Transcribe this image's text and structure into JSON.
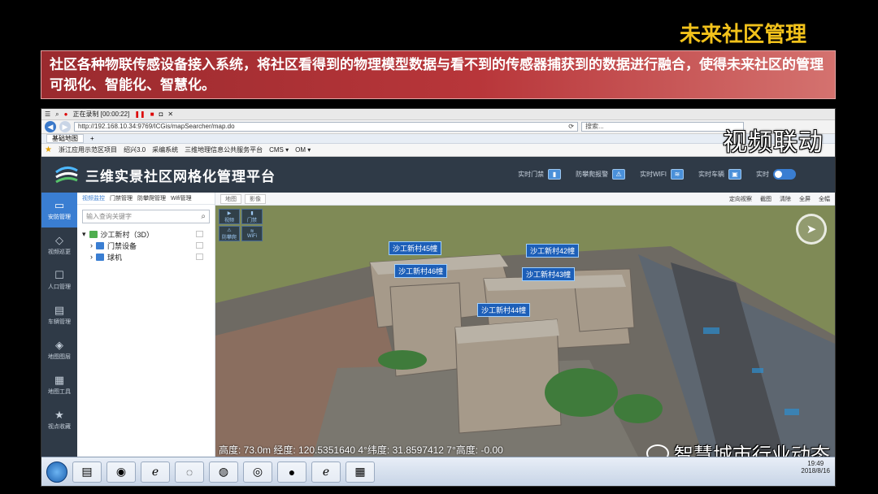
{
  "slide": {
    "title": "未来社区管理",
    "banner": "社区各种物联传感设备接入系统，将社区看得到的物理模型数据与看不到的传感器捕获到的数据进行融合，使得未来社区的管理可视化、智能化、智慧化。",
    "video_link": "视频联动",
    "watermark": "智慧城市行业动态"
  },
  "browser": {
    "recording": "正在录制 [00:00:22]",
    "url": "http://192.168.10.34:9769/ICGis/mapSearcher/map.do",
    "search_placeholder": "搜索...",
    "tab": "基础地图",
    "favorites": [
      "浙江应用示范区项目",
      "绍兴3.0",
      "采编系统",
      "三维地理信息公共服务平台",
      "CMS ▾",
      "OM ▾"
    ]
  },
  "app": {
    "title": "三维实景社区网格化管理平台",
    "header_tools": [
      "实时门禁",
      "防攀爬报警",
      "实时WIFI",
      "实时车辆",
      "实时"
    ],
    "sidebar": [
      "安防管理",
      "视频巡更",
      "人口管理",
      "车辆管理",
      "地图图层",
      "地图工具",
      "视点收藏"
    ],
    "subtabs": [
      "视频监控",
      "门禁管理",
      "防攀爬管理",
      "Wifi管理"
    ],
    "search_placeholder": "输入查询关键字",
    "tree": {
      "root": "沙工新村（3D）",
      "children": [
        "门禁设备",
        "球机"
      ]
    },
    "toolbar_left": [
      "地图",
      "影像"
    ],
    "toolbar_right": [
      "定向视察",
      "截图",
      "清除",
      "全屏",
      "全幅"
    ],
    "quick_tools": [
      "视频",
      "门禁",
      "防攀爬",
      "WiFi"
    ],
    "building_labels": [
      "沙工新村45幢",
      "沙工新村42幢",
      "沙工新村46幢",
      "沙工新村43幢",
      "沙工新村44幢"
    ],
    "status": "高度:  73.0m   经度:  120.5351640 4°纬度:  31.8597412 7°高度:  -0.00"
  },
  "taskbar": {
    "time": "19:49",
    "date": "2018/8/16"
  }
}
